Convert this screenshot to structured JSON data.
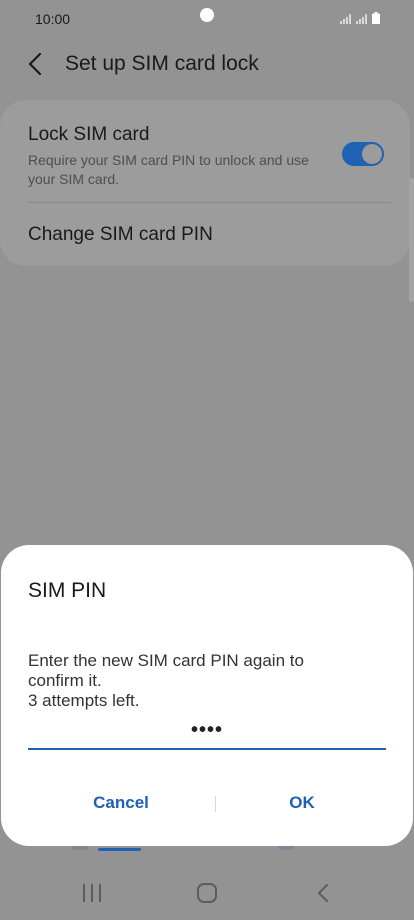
{
  "status_bar": {
    "time": "10:00"
  },
  "header": {
    "title": "Set up SIM card lock"
  },
  "settings": {
    "lock_sim": {
      "title": "Lock SIM card",
      "description": "Require your SIM card PIN to unlock and use your SIM card.",
      "enabled": true
    },
    "change_pin": {
      "title": "Change SIM card PIN"
    }
  },
  "dialog": {
    "title": "SIM PIN",
    "message": "Enter the new SIM card PIN again to\nconfirm it.\n3 attempts left.",
    "pin_value": "••••",
    "cancel_label": "Cancel",
    "ok_label": "OK"
  },
  "colors": {
    "accent": "#1f62b3",
    "scrim_background": "#939393",
    "dialog_background": "#ffffff"
  }
}
